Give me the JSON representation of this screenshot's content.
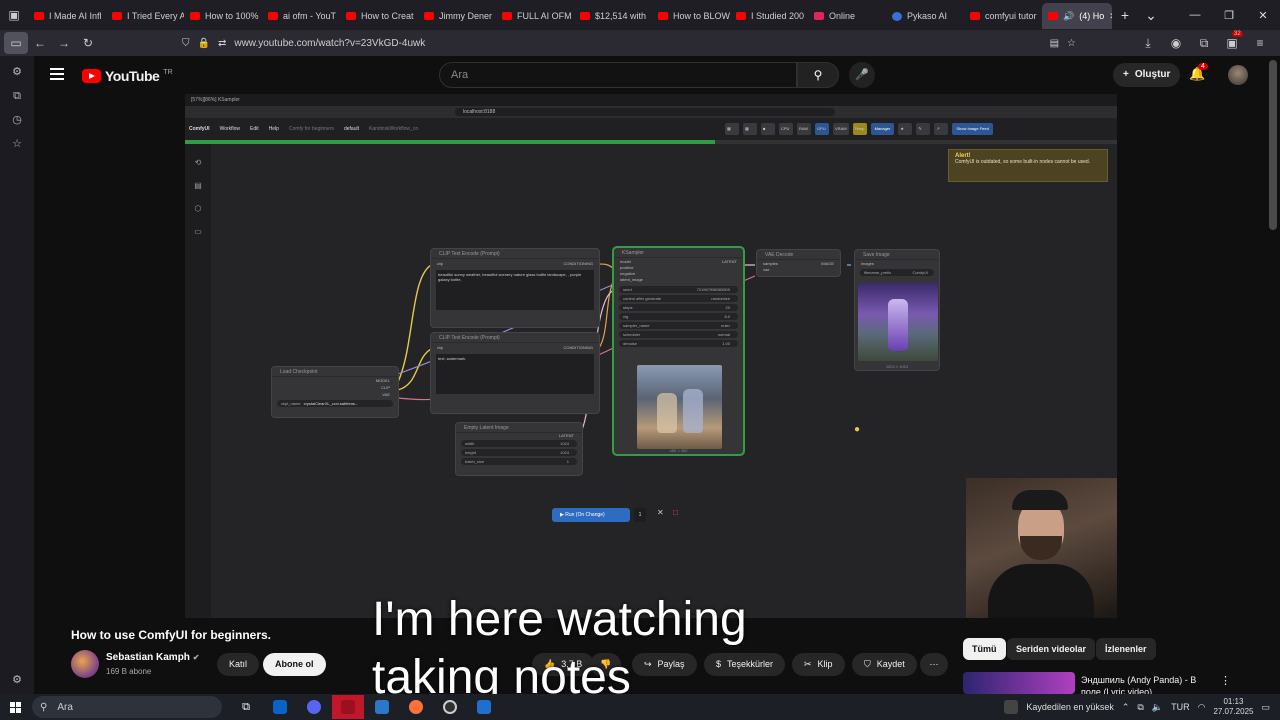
{
  "browser": {
    "tabs": [
      {
        "label": "I Made AI Infl"
      },
      {
        "label": "I Tried Every A"
      },
      {
        "label": "How to 100%"
      },
      {
        "label": "ai ofm - YouT"
      },
      {
        "label": "How to Creat"
      },
      {
        "label": "Jimmy Dener"
      },
      {
        "label": "FULL AI OFM"
      },
      {
        "label": "$12,514 with"
      },
      {
        "label": "How to BLOW"
      },
      {
        "label": "I Studied 200"
      },
      {
        "label": "Online"
      },
      {
        "label": "Pykaso AI"
      },
      {
        "label": "comfyui tutor"
      }
    ],
    "active_tab": {
      "label": "(4) Ho"
    },
    "url": "www.youtube.com/watch?v=23VkGD-4uwk",
    "extensions_badge": "32"
  },
  "youtube": {
    "logo_text": "YouTube",
    "region": "TR",
    "search_placeholder": "Ara",
    "create_label": "Oluştur",
    "notifications_count": "4"
  },
  "video": {
    "comfy": {
      "tab_title": "[57%][86%] KSampler",
      "url": "localhost:8188",
      "menu": [
        "ComfyUI",
        "Workflow",
        "Edit",
        "Help",
        "Comfy for beginners",
        "default",
        "KandinskWorkflow_co"
      ],
      "progress_label": "[57%] 57% ▸ KSampler [86%]",
      "manager_label": "Manager",
      "image_feed_label": "Show Image Feed",
      "alert": {
        "title": "Alert!",
        "message": "ComfyUI is outdated, so some built-in nodes cannot be used."
      },
      "nodes": {
        "clip_pos": {
          "title": "CLIP Text Encode (Prompt)",
          "input": "clip",
          "output": "CONDITIONING",
          "text": "beautiful sunny weather, beautiful scenery nature glass bottle landscape, , purple galaxy bottle,"
        },
        "clip_neg": {
          "title": "CLIP Text Encode (Prompt)",
          "input": "clip",
          "output": "CONDITIONING",
          "text": "text, watermark"
        },
        "checkpoint": {
          "title": "Load Checkpoint",
          "outputs": [
            "MODEL",
            "CLIP",
            "VAE"
          ],
          "ckpt_label": "ckpt_name",
          "ckpt_value": "crystalClearXL_ccxl.safetens..."
        },
        "latent": {
          "title": "Empty Latent Image",
          "output": "LATENT",
          "width": "1024",
          "height": "1024",
          "batch_size": "1"
        },
        "ksampler": {
          "title": "KSampler",
          "inputs": [
            "model",
            "positive",
            "negative",
            "latent_image"
          ],
          "output": "LATENT",
          "rows": [
            {
              "k": "seed",
              "v": "721967956065509"
            },
            {
              "k": "control after generate",
              "v": "randomize"
            },
            {
              "k": "steps",
              "v": "20"
            },
            {
              "k": "cfg",
              "v": "8.0"
            },
            {
              "k": "sampler_name",
              "v": "euler"
            },
            {
              "k": "scheduler",
              "v": "normal"
            },
            {
              "k": "denoise",
              "v": "1.00"
            }
          ],
          "preview_caption": "450 × 450"
        },
        "vae": {
          "title": "VAE Decode",
          "inputs": [
            "samples",
            "vae"
          ],
          "output": "IMAGE"
        },
        "save": {
          "title": "Save Image",
          "input": "images",
          "prefix_label": "filename_prefix",
          "prefix_value": "ComfyUI",
          "caption": "1024 × 1024"
        }
      },
      "run_label": "Run (On Change)",
      "run_count": "1"
    }
  },
  "info": {
    "title": "How to use ComfyUI for beginners.",
    "channel": "Sebastian Kamph",
    "subscribers": "169 B abone",
    "join_label": "Katıl",
    "subscribe_label": "Abone ol",
    "likes": "3,7 B",
    "share_label": "Paylaş",
    "thanks_label": "Teşekkürler",
    "clip_label": "Klip",
    "save_label": "Kaydet"
  },
  "recommendations": {
    "chips": [
      "Tümü",
      "Seriden videolar",
      "İzlenenler"
    ],
    "first_title": "Эндшпиль (Andy Panda) - В поле (Lyric video)"
  },
  "subtitle": {
    "line1": "I'm here watching",
    "line2": "taking notes"
  },
  "taskbar": {
    "search_placeholder": "Ara",
    "notification_text": "Kaydedilen en yüksek",
    "language": "TUR",
    "time": "01:13",
    "date": "27.07.2025"
  },
  "colors": {
    "youtube_red": "#ff0000",
    "comfy_green": "#2ea043",
    "comfy_blue": "#2d6cc0"
  }
}
